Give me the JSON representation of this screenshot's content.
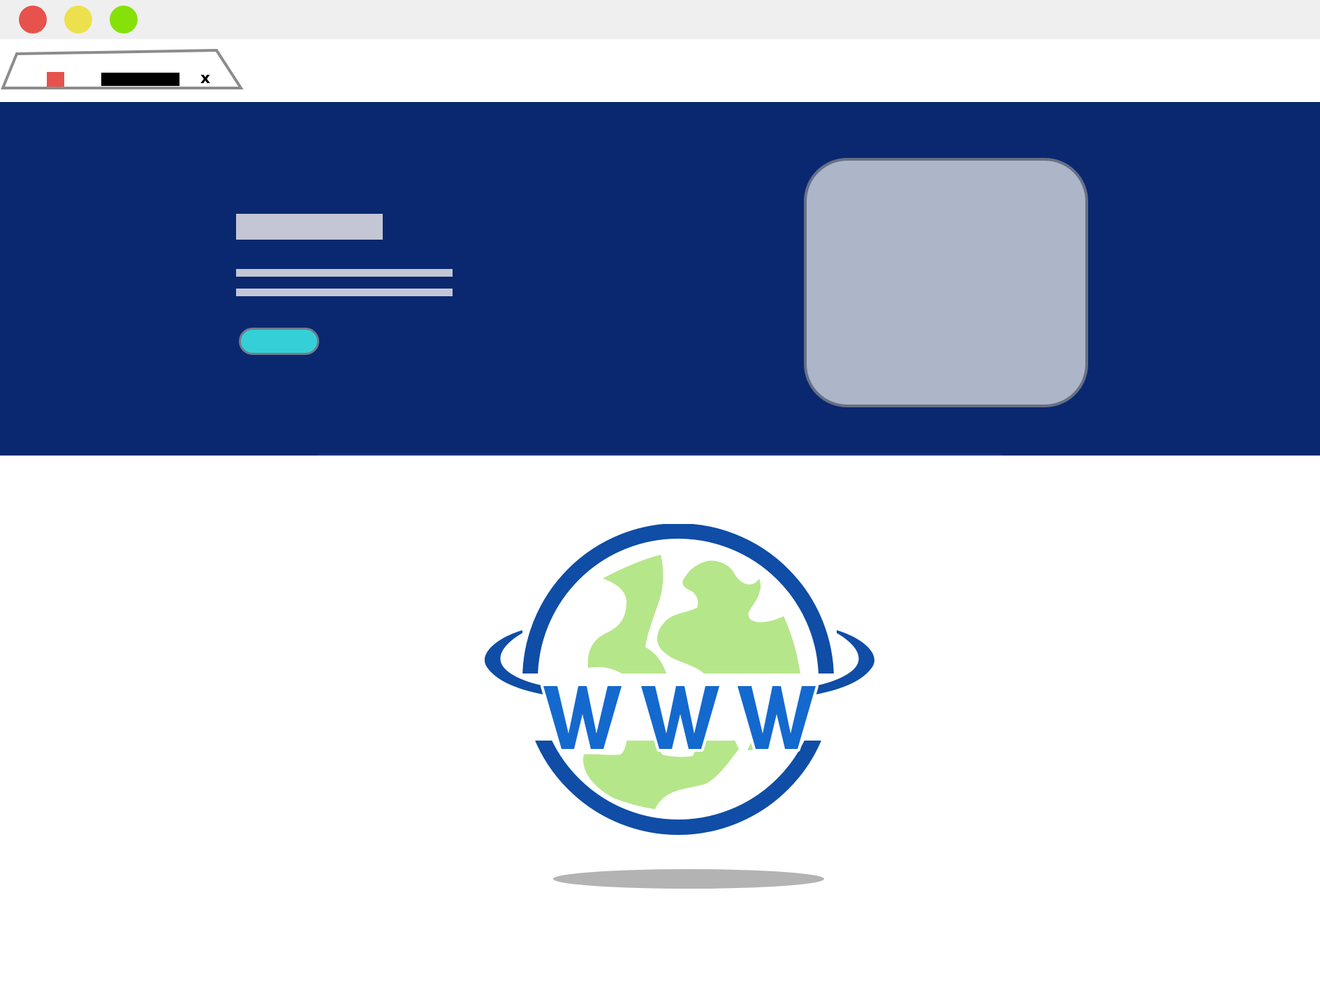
{
  "window": {
    "controls": [
      {
        "name": "close",
        "color": "#e7524d"
      },
      {
        "name": "minimize",
        "color": "#ece14c"
      },
      {
        "name": "maximize",
        "color": "#86e109"
      }
    ]
  },
  "tab": {
    "close_label": "x",
    "favicon_color": "#e7524d",
    "title_placeholder_color": "#000000",
    "outline_color": "#8c8c8c"
  },
  "hero": {
    "background": "#0a2870",
    "title_placeholder_color": "#c3c6d5",
    "text_line_color": "#c3c6d5",
    "cta_color": "#35d0d7",
    "image_placeholder_color": "#adb5c9"
  },
  "logo": {
    "wordmark": "WWW",
    "ring_color": "#0f4da6",
    "land_color": "#b6e68a",
    "letter_color": "#1469cf",
    "shadow_color": "#b3b3b3"
  }
}
